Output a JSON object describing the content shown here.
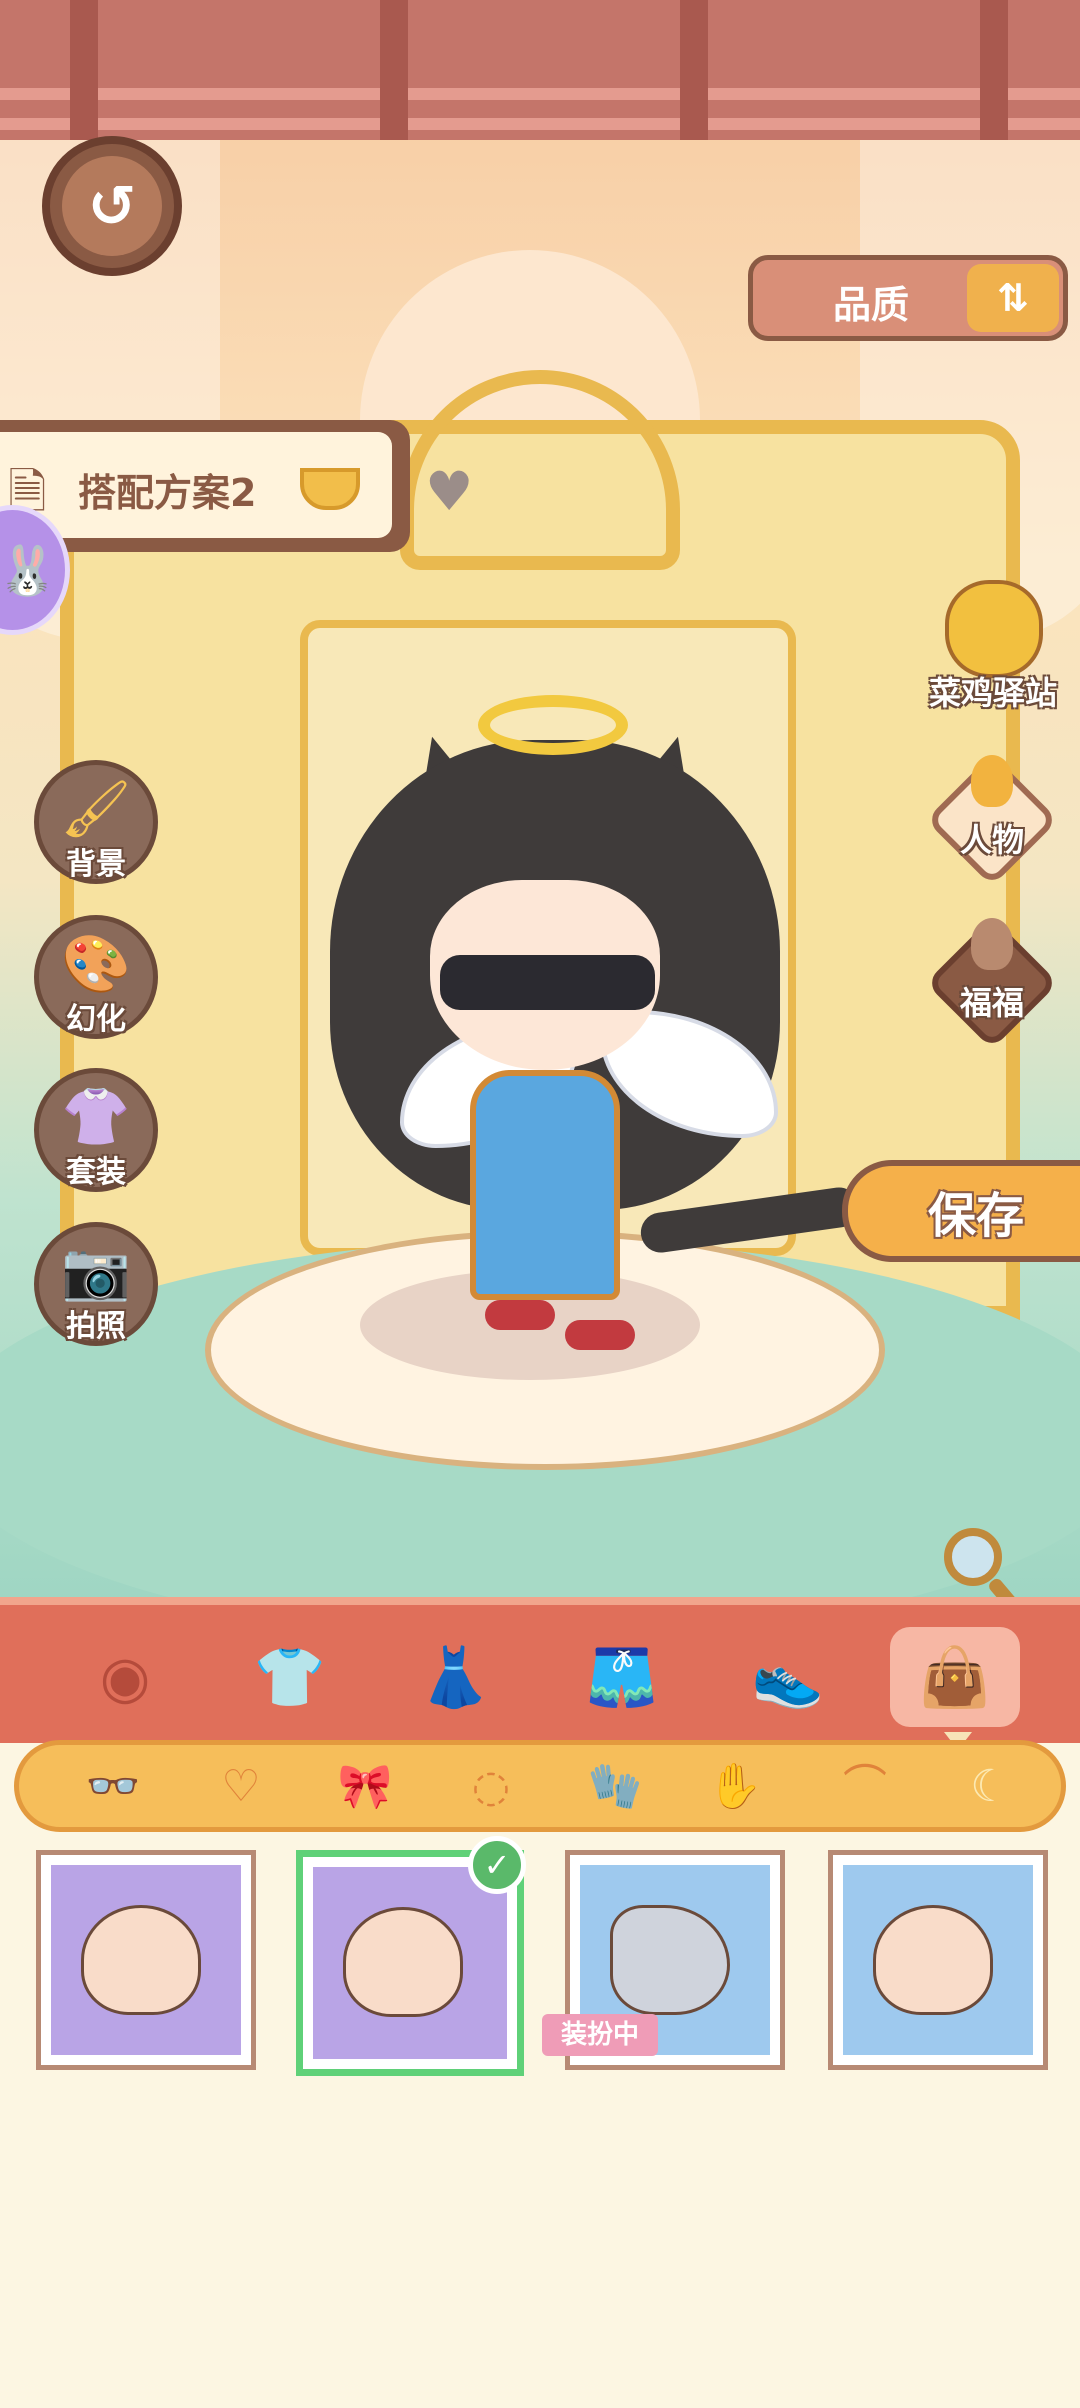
{
  "header": {
    "back_icon": "back-arrow-icon",
    "quality_label": "品质",
    "quality_sort_icon": "sort-icon"
  },
  "outfit_plan": {
    "label": "搭配方案2",
    "plan_icon": "document-icon",
    "dropdown_icon": "chevron-down-icon",
    "favorite_icon": "heart-icon"
  },
  "left_menu": [
    {
      "label": "背景",
      "icon": "brush-icon"
    },
    {
      "label": "幻化",
      "icon": "palette-icon"
    },
    {
      "label": "套装",
      "icon": "hanger-icon"
    },
    {
      "label": "拍照",
      "icon": "camera-icon"
    }
  ],
  "right_menu": {
    "station_label": "菜鸡驿站",
    "character_label": "人物",
    "pet_label": "福福"
  },
  "save_label": "保存",
  "categories": [
    {
      "icon": "eye-icon",
      "selected": false
    },
    {
      "icon": "shirt-icon",
      "selected": false
    },
    {
      "icon": "dress-icon",
      "selected": false
    },
    {
      "icon": "shorts-icon",
      "selected": false
    },
    {
      "icon": "shoes-icon",
      "selected": false
    },
    {
      "icon": "bag-icon",
      "selected": true
    }
  ],
  "subcategories": [
    {
      "icon": "glasses-icon",
      "selected": false
    },
    {
      "icon": "necklace-icon",
      "selected": false
    },
    {
      "icon": "bow-icon",
      "selected": false
    },
    {
      "icon": "bracelet-icon",
      "selected": false
    },
    {
      "icon": "glove-icon",
      "selected": false
    },
    {
      "icon": "mitten-icon",
      "selected": false
    },
    {
      "icon": "wings-icon",
      "selected": false
    },
    {
      "icon": "tail-icon",
      "selected": true
    }
  ],
  "items": [
    {
      "name": "pink-cat-tail",
      "bg": "purple",
      "equipped": false
    },
    {
      "name": "black-cat-tail",
      "bg": "purple",
      "equipped": true
    },
    {
      "name": "grey-fluffy-tail",
      "bg": "blue",
      "equipped": false
    },
    {
      "name": "devil-tail",
      "bg": "blue",
      "equipped": false
    }
  ],
  "equipped_tag": "装扮中",
  "colors": {
    "accent_red": "#e06f5a",
    "accent_orange": "#f6be5a",
    "brown": "#8a5a44",
    "equipped_green": "#5fd178"
  }
}
